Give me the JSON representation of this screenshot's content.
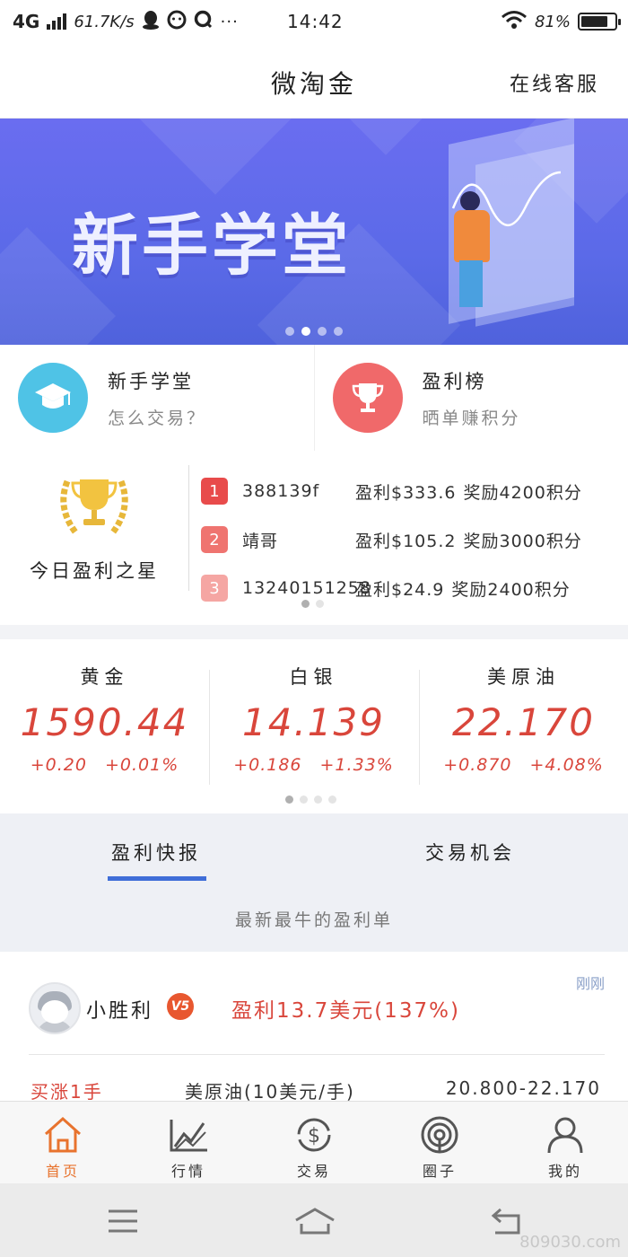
{
  "status_bar": {
    "network": "4G",
    "speed": "61.7K/s",
    "more": "···",
    "time": "14:42",
    "battery": "81%",
    "battery_level": 0.81
  },
  "header": {
    "title": "微淘金",
    "service": "在线客服"
  },
  "banner": {
    "headline": "新手学堂",
    "dot_count": 4,
    "active_dot": 1
  },
  "quick_entries": [
    {
      "title": "新手学堂",
      "subtitle": "怎么交易？",
      "icon": "graduation-cap-icon",
      "color": "#4fc3e6"
    },
    {
      "title": "盈利榜",
      "subtitle": "晒单赚积分",
      "icon": "trophy-icon",
      "color": "#f0696a"
    }
  ],
  "stars": {
    "label": "今日盈利之星",
    "rows": [
      {
        "rank": "1",
        "name": "388139f",
        "profit": "盈利$333.6",
        "reward": "奖励4200积分",
        "color": "#e84b4b"
      },
      {
        "rank": "2",
        "name": "靖哥",
        "profit": "盈利$105.2",
        "reward": "奖励3000积分",
        "color": "#ef7470"
      },
      {
        "rank": "3",
        "name": "13240151258",
        "profit": "盈利$24.9",
        "reward": "奖励2400积分",
        "color": "#f5a6a3"
      }
    ]
  },
  "quotes": [
    {
      "name": "黄金",
      "price": "1590.44",
      "change": "+0.20",
      "percent": "+0.01%"
    },
    {
      "name": "白银",
      "price": "14.139",
      "change": "+0.186",
      "percent": "+1.33%"
    },
    {
      "name": "美原油",
      "price": "22.170",
      "change": "+0.870",
      "percent": "+4.08%"
    }
  ],
  "tabs": {
    "items": [
      "盈利快报",
      "交易机会"
    ],
    "active": 0,
    "subtitle": "最新最牛的盈利单"
  },
  "feed": {
    "username": "小胜利",
    "vip": "V5",
    "gain": "盈利13.7美元(137%)",
    "time": "刚刚",
    "direction": "买涨1手",
    "product": "美原油(10美元/手)",
    "range": "20.800-22.170"
  },
  "bottom_nav": [
    {
      "label": "首页",
      "icon": "home-icon",
      "active": true
    },
    {
      "label": "行情",
      "icon": "chart-icon",
      "active": false
    },
    {
      "label": "交易",
      "icon": "trade-dollar-icon",
      "active": false
    },
    {
      "label": "圈子",
      "icon": "circle-broadcast-icon",
      "active": false
    },
    {
      "label": "我的",
      "icon": "user-icon",
      "active": false
    }
  ],
  "watermark": "809030.com",
  "colors": {
    "up_red": "#d9463b",
    "accent_blue": "#3f6ed8",
    "nav_active": "#e8732e"
  }
}
